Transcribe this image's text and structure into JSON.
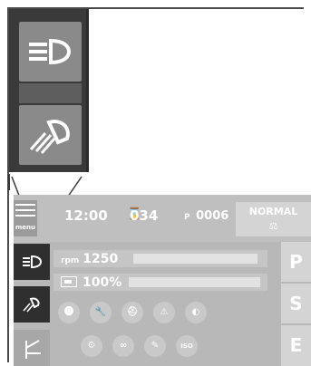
{
  "zoom_panel": {
    "items": [
      {
        "icon": "headlight-icon"
      },
      {
        "icon": "work-light-icon"
      }
    ]
  },
  "display": {
    "menu_label": "menu",
    "time": "12:00",
    "hours_icon": "⌛",
    "hours": "034",
    "program_prefix": "P",
    "program": "0006",
    "mode_label": "NORMAL",
    "mode_icon": "⚖",
    "gauges": {
      "rpm_unit": "rpm",
      "rpm_value": "1250",
      "rpm_level": 0.9,
      "battery_value": "100%",
      "battery_level": 1.0
    },
    "right_buttons": [
      "P",
      "S",
      "E"
    ],
    "status_icons": [
      {
        "name": "brake-warning-icon",
        "glyph": "⓿"
      },
      {
        "name": "wrench-icon",
        "glyph": "🔧"
      },
      {
        "name": "seat-belt-icon",
        "glyph": "⛑"
      },
      {
        "name": "warning-triangle-icon",
        "glyph": "⚠"
      },
      {
        "name": "diagonal-split-icon",
        "glyph": "◐"
      },
      {
        "name": "connector-icon",
        "glyph": "⚙"
      },
      {
        "name": "chain-icon",
        "glyph": "∞"
      },
      {
        "name": "pen-icon",
        "glyph": "✎"
      },
      {
        "name": "iso-icon",
        "glyph": "ISO"
      }
    ]
  },
  "colors": {
    "panel_dark": "#3a3a3a",
    "tile_gray": "#8a8a8a",
    "screen_bg": "#b8b8b8",
    "active_tile": "#2f2f2f"
  }
}
